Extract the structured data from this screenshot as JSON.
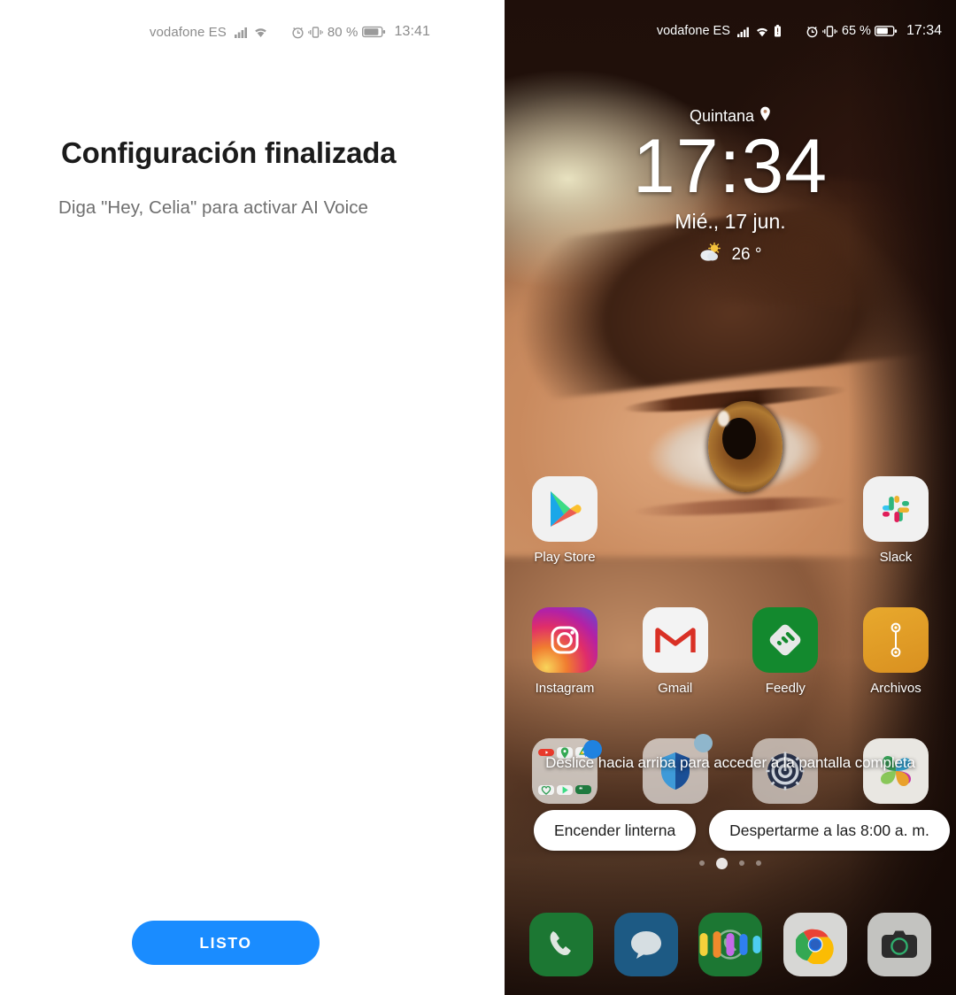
{
  "left_screen": {
    "status_bar": {
      "carrier": "vodafone ES",
      "battery_percent": "80 %",
      "clock": "13:41",
      "icons": [
        "signal-icon",
        "wifi-icon",
        "alarm-icon",
        "vibrate-icon",
        "battery-icon"
      ]
    },
    "title": "Configuración finalizada",
    "subtitle": "Diga \"Hey, Celia\" para activar AI Voice",
    "done_button": "LISTO",
    "accent_color": "#1a8cff"
  },
  "right_screen": {
    "status_bar": {
      "carrier": "vodafone ES",
      "battery_percent": "65 %",
      "clock": "17:34",
      "icons": [
        "signal-icon",
        "wifi-icon",
        "battery-saver-icon",
        "alarm-icon",
        "vibrate-icon",
        "battery-icon"
      ]
    },
    "clock_widget": {
      "location": "Quintana",
      "time": "17:34",
      "date": "Mié., 17 jun.",
      "temperature": "26 °",
      "weather_icon": "partly-cloudy-icon"
    },
    "app_grid": [
      [
        {
          "label": "Play Store",
          "icon": "play-store-icon",
          "badge": null
        },
        {
          "label": "",
          "icon": null,
          "badge": null
        },
        {
          "label": "",
          "icon": null,
          "badge": null
        },
        {
          "label": "Slack",
          "icon": "slack-icon",
          "badge": null
        }
      ],
      [
        {
          "label": "Instagram",
          "icon": "instagram-icon",
          "badge": null
        },
        {
          "label": "Gmail",
          "icon": "gmail-icon",
          "badge": null
        },
        {
          "label": "Feedly",
          "icon": "feedly-icon",
          "badge": null
        },
        {
          "label": "Archivos",
          "icon": "files-icon",
          "badge": null
        }
      ],
      [
        {
          "label": "",
          "icon": "folder-icon",
          "badge": "dot"
        },
        {
          "label": "",
          "icon": "shield-icon",
          "badge": "dot-pale"
        },
        {
          "label": "",
          "icon": "gear-icon",
          "badge": null
        },
        {
          "label": "",
          "icon": "photos-icon",
          "badge": null
        }
      ]
    ],
    "hint_text": "Deslice hacia arriba para acceder a la pantalla completa",
    "suggestion_chips": [
      "Encender linterna",
      "Despertarme a las 8:00 a. m."
    ],
    "page_dots": {
      "count": 4,
      "active_index": 1
    },
    "dock": [
      {
        "icon": "phone-icon",
        "color": "#1e7a34"
      },
      {
        "icon": "messages-icon",
        "color": "#1f5c86"
      },
      {
        "icon": "whatsapp-icon",
        "color": "#1e7a34",
        "overlay": "ai-voice-bars"
      },
      {
        "icon": "chrome-icon",
        "color": "#d8d8d8"
      },
      {
        "icon": "camera-icon",
        "color": "#bcbcbc"
      }
    ],
    "voice_bar_colors": [
      "#f5d13b",
      "#f08a2c",
      "#c36ae8",
      "#2f7ff0",
      "#4ecdf0"
    ]
  }
}
